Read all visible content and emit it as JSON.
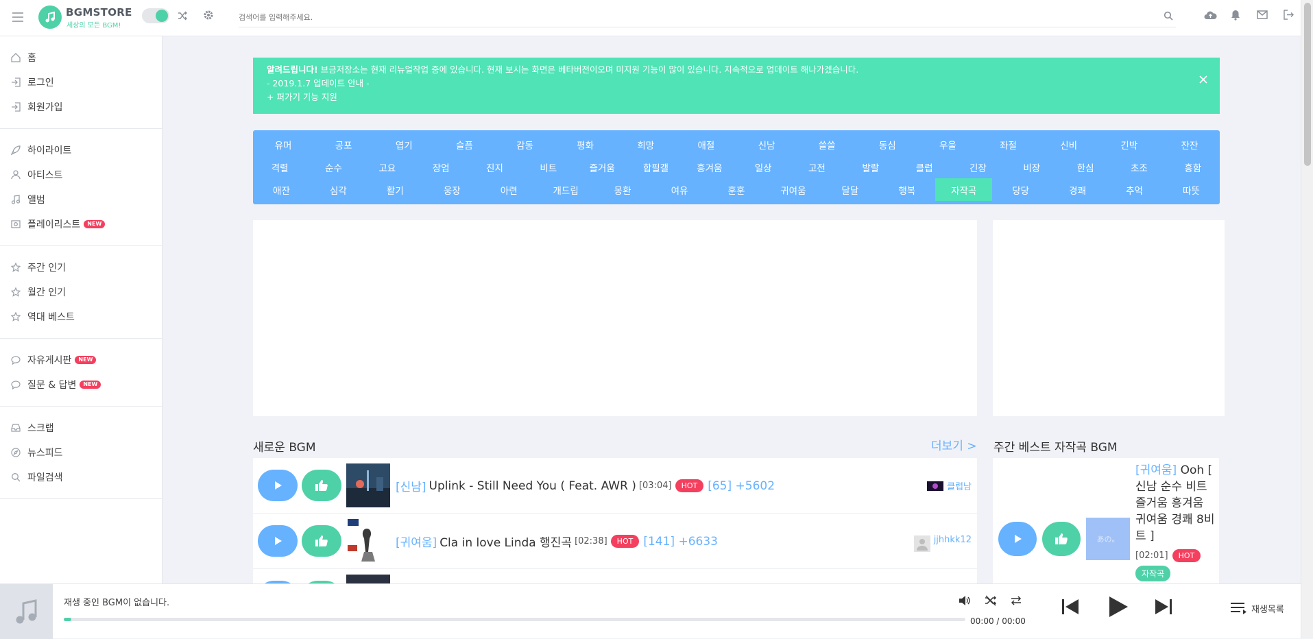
{
  "header": {
    "brand_name": "BGMSTORE",
    "brand_sub": "세상의 모든 BGM!",
    "search_placeholder": "검색어를 입력해주세요."
  },
  "sidebar": {
    "groups": [
      [
        {
          "label": "홈",
          "icon": "home-icon"
        },
        {
          "label": "로그인",
          "icon": "login-icon"
        },
        {
          "label": "회원가입",
          "icon": "signup-icon"
        }
      ],
      [
        {
          "label": "하이라이트",
          "icon": "rocket-icon"
        },
        {
          "label": "아티스트",
          "icon": "user-icon"
        },
        {
          "label": "앨범",
          "icon": "music-note-icon"
        },
        {
          "label": "플레이리스트",
          "icon": "playlist-icon",
          "badge": "NEW"
        }
      ],
      [
        {
          "label": "주간 인기",
          "icon": "star-icon"
        },
        {
          "label": "월간 인기",
          "icon": "star-icon"
        },
        {
          "label": "역대 베스트",
          "icon": "star-icon"
        }
      ],
      [
        {
          "label": "자유게시판",
          "icon": "chat-icon",
          "badge": "NEW"
        },
        {
          "label": "질문 & 답변",
          "icon": "chat-icon",
          "badge": "NEW"
        }
      ],
      [
        {
          "label": "스크랩",
          "icon": "inbox-icon"
        },
        {
          "label": "뉴스피드",
          "icon": "compass-icon"
        },
        {
          "label": "파일검색",
          "icon": "search-icon"
        }
      ]
    ]
  },
  "alert": {
    "bold": "알려드립니다!",
    "line1": " 브금저장소는 현재 리뉴얼작업 중에 있습니다. 현재 보시는 화면은 베타버전이오며 미지원 기능이 많이 있습니다. 지속적으로 업데이트 해나가겠습니다.",
    "line2": "- 2019.1.7 업데이트 안내 -",
    "line3": "+ 퍼가기 기능 지원"
  },
  "genres": {
    "rows": [
      [
        "유머",
        "공포",
        "엽기",
        "슬픔",
        "감동",
        "평화",
        "희망",
        "애절",
        "신남",
        "쓸쓸",
        "동심",
        "우울",
        "좌절",
        "신비",
        "긴박",
        "잔잔"
      ],
      [
        "격렬",
        "순수",
        "고요",
        "장엄",
        "진지",
        "비트",
        "즐거움",
        "합필갤",
        "흥겨움",
        "일상",
        "고전",
        "발랄",
        "클럽",
        "긴장",
        "비장",
        "한심",
        "초조",
        "흥함"
      ],
      [
        "애잔",
        "심각",
        "활기",
        "웅장",
        "아련",
        "개드립",
        "몽환",
        "여유",
        "훈훈",
        "귀여움",
        "달달",
        "행복",
        "자작곡",
        "당당",
        "경쾌",
        "추억",
        "따뜻"
      ]
    ],
    "active": "자작곡"
  },
  "new_bgm": {
    "title": "새로운 BGM",
    "more": "더보기 >",
    "songs": [
      {
        "category": "[신남]",
        "title": "Uplink - Still Need You ( Feat. AWR )",
        "duration": "[03:04]",
        "hot": "HOT",
        "stats": "[65] +5602",
        "uploader": "클럽남"
      },
      {
        "category": "[귀여움]",
        "title": "Cla in love Linda 행진곡",
        "duration": "[02:38]",
        "hot": "HOT",
        "stats": "[141] +6633",
        "uploader": "jjhhkk12"
      }
    ]
  },
  "weekly": {
    "title": "주간 베스트 자작곡 BGM",
    "category": "[귀여움]",
    "song": " Ooh [ 신남 순수 비트 즐거움 흥겨움 귀여움 경쾌 8비트 ]",
    "duration": "[02:01]",
    "hot": "HOT",
    "tag": "자작곡",
    "thumb_text": "あの。"
  },
  "player": {
    "status": "재생 중인 BGM이 없습니다.",
    "time": "00:00 / 00:00",
    "progress": 0.006,
    "playlist_label": "재생목록"
  },
  "colors": {
    "accent": "#4fd1a8",
    "blue": "#66b2ff",
    "alert": "#4fe3b5",
    "hot": "#f43f5e"
  }
}
